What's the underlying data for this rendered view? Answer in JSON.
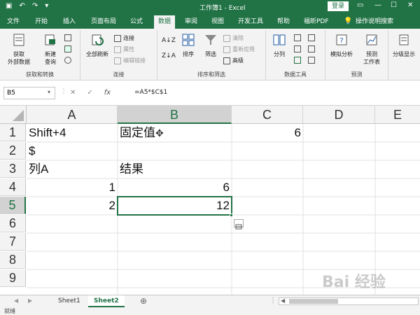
{
  "titlebar": {
    "title": "工作簿1 - Excel",
    "login": "登录"
  },
  "tabs": [
    "文件",
    "开始",
    "插入",
    "页面布局",
    "公式",
    "数据",
    "审阅",
    "视图",
    "开发工具",
    "帮助",
    "福昕PDF",
    "操作说明搜索"
  ],
  "active_tab": "数据",
  "ribbon": {
    "get_data": "获取\n外部数据",
    "new_query": "新建\n查询",
    "group1_label": "获取和转换",
    "refresh_all": "全部刷新",
    "connections": "连接",
    "properties": "属性",
    "edit_links": "编辑链接",
    "group2_label": "连接",
    "sort": "排序",
    "filter": "筛选",
    "clear": "清除",
    "reapply": "重新应用",
    "advanced": "高级",
    "group3_label": "排序和筛选",
    "split": "分列",
    "group4_label": "数据工具",
    "whatif": "模拟分析",
    "forecast": "预测\n工作表",
    "group5_label": "预测",
    "outline": "分级显示"
  },
  "formula_bar": {
    "name_box": "B5",
    "fx": "fx",
    "formula": "=A5*$C$1"
  },
  "columns": [
    "A",
    "B",
    "C",
    "D",
    "E"
  ],
  "rows": [
    "1",
    "2",
    "3",
    "4",
    "5",
    "6",
    "7",
    "8",
    "9"
  ],
  "cells": {
    "A1": "Shift+4",
    "B1": "固定值",
    "C1": "6",
    "A2": "$",
    "A3": "列A",
    "B3": "结果",
    "A4": "1",
    "B4": "6",
    "A5": "2",
    "B5": "12"
  },
  "sheets": [
    "Sheet1",
    "Sheet2"
  ],
  "active_sheet": "Sheet2",
  "status": "就绪",
  "watermark": "Bai 经验"
}
